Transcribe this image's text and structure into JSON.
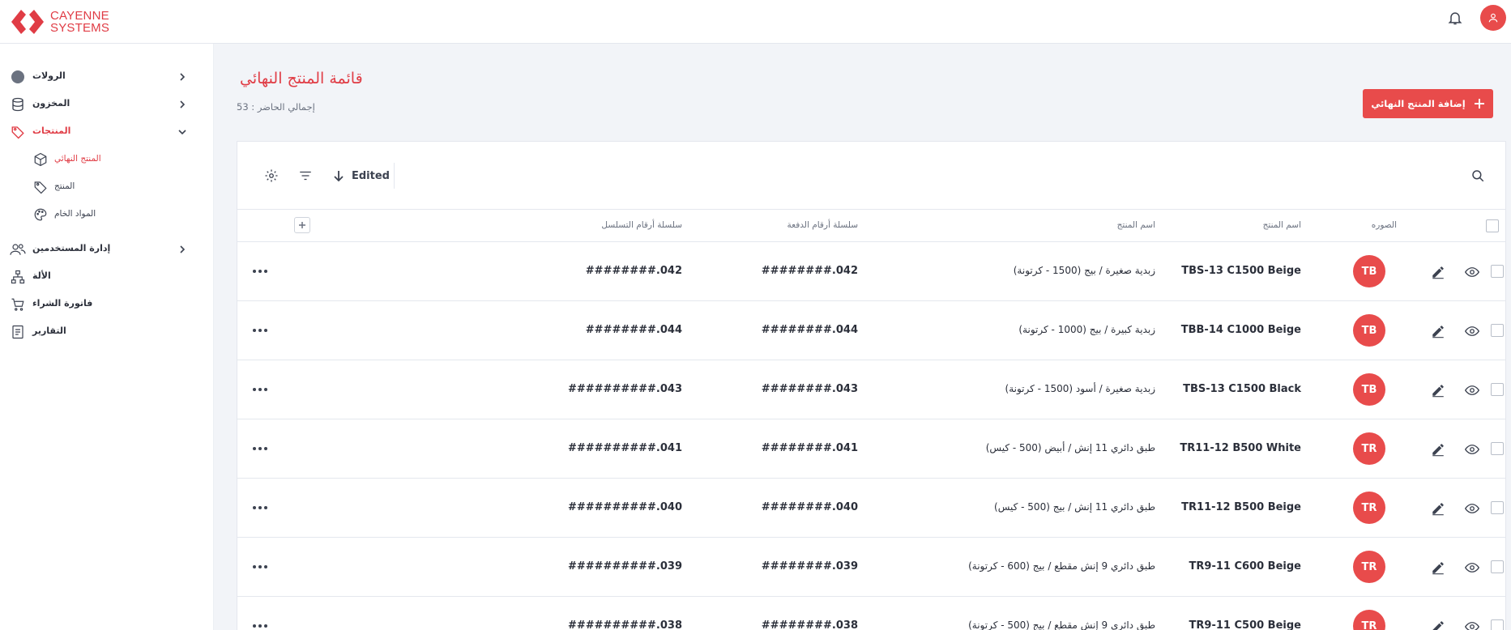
{
  "brand": {
    "line1": "CAYENNE",
    "line2": "SYSTEMS",
    "color": "#e03c45"
  },
  "accent_color": "#e84b4b",
  "header": {
    "bell_icon": "bell-icon",
    "user_icon": "user-icon"
  },
  "sidebar": {
    "items": [
      {
        "label": "الرولات",
        "icon": "circle-icon"
      },
      {
        "label": "المخزون",
        "icon": "database-icon"
      },
      {
        "label": "المنتجات",
        "icon": "tag-icon"
      },
      {
        "label": "إدارة المستخدمين",
        "icon": "users-icon"
      },
      {
        "label": "الألة",
        "icon": "hierarchy-icon"
      },
      {
        "label": "فاتورة الشراء",
        "icon": "cart-icon"
      },
      {
        "label": "التقارير",
        "icon": "report-icon"
      }
    ],
    "subitems": [
      {
        "label": "المنتج النهائي",
        "icon": "cube-icon"
      },
      {
        "label": "المنتج",
        "icon": "tag-icon"
      },
      {
        "label": "المواد الخام",
        "icon": "palette-icon"
      }
    ]
  },
  "page": {
    "title": "قائمة المنتج النهائي",
    "subtitle": "إجمالي الحاضر : 53",
    "add_button": "إضافة المنتج النهائي"
  },
  "toolbar": {
    "sort_label": "Edited"
  },
  "table": {
    "headers": {
      "serial": "سلسلة أرقام التسلسل",
      "lot": "سلسلة أرقام الدفعة",
      "name": "اسم المنتج",
      "code": "اسم المنتج",
      "image": "الصوره"
    },
    "rows": [
      {
        "serial": "########.042",
        "lot": "########.042",
        "name": "زبدية صغيرة / بيج (1500 - كرتونة)",
        "code": "TBS-13 C1500 Beige",
        "badge": "TB"
      },
      {
        "serial": "########.044",
        "lot": "########.044",
        "name": "زبدية كبيرة / بيج (1000 - كرتونة)",
        "code": "TBB-14 C1000 Beige",
        "badge": "TB"
      },
      {
        "serial": "##########.043",
        "lot": "########.043",
        "name": "زبدية صغيرة / أسود (1500 - كرتونة)",
        "code": "TBS-13 C1500 Black",
        "badge": "TB"
      },
      {
        "serial": "##########.041",
        "lot": "########.041",
        "name": "طبق دائري 11 إنش / أبيض (500 - كيس)",
        "code": "TR11-12 B500 White",
        "badge": "TR"
      },
      {
        "serial": "##########.040",
        "lot": "########.040",
        "name": "طبق دائري 11 إنش / بيج (500 - كيس)",
        "code": "TR11-12 B500 Beige",
        "badge": "TR"
      },
      {
        "serial": "##########.039",
        "lot": "########.039",
        "name": "طبق دائري 9 إنش مقطع / بيج (600 - كرتونة)",
        "code": "TR9-11 C600 Beige",
        "badge": "TR"
      },
      {
        "serial": "##########.038",
        "lot": "########.038",
        "name": "طبق دائري 9 إنش مقطع / بيج (500 - كرتونة)",
        "code": "TR9-11 C500 Beige",
        "badge": "TR"
      }
    ]
  }
}
